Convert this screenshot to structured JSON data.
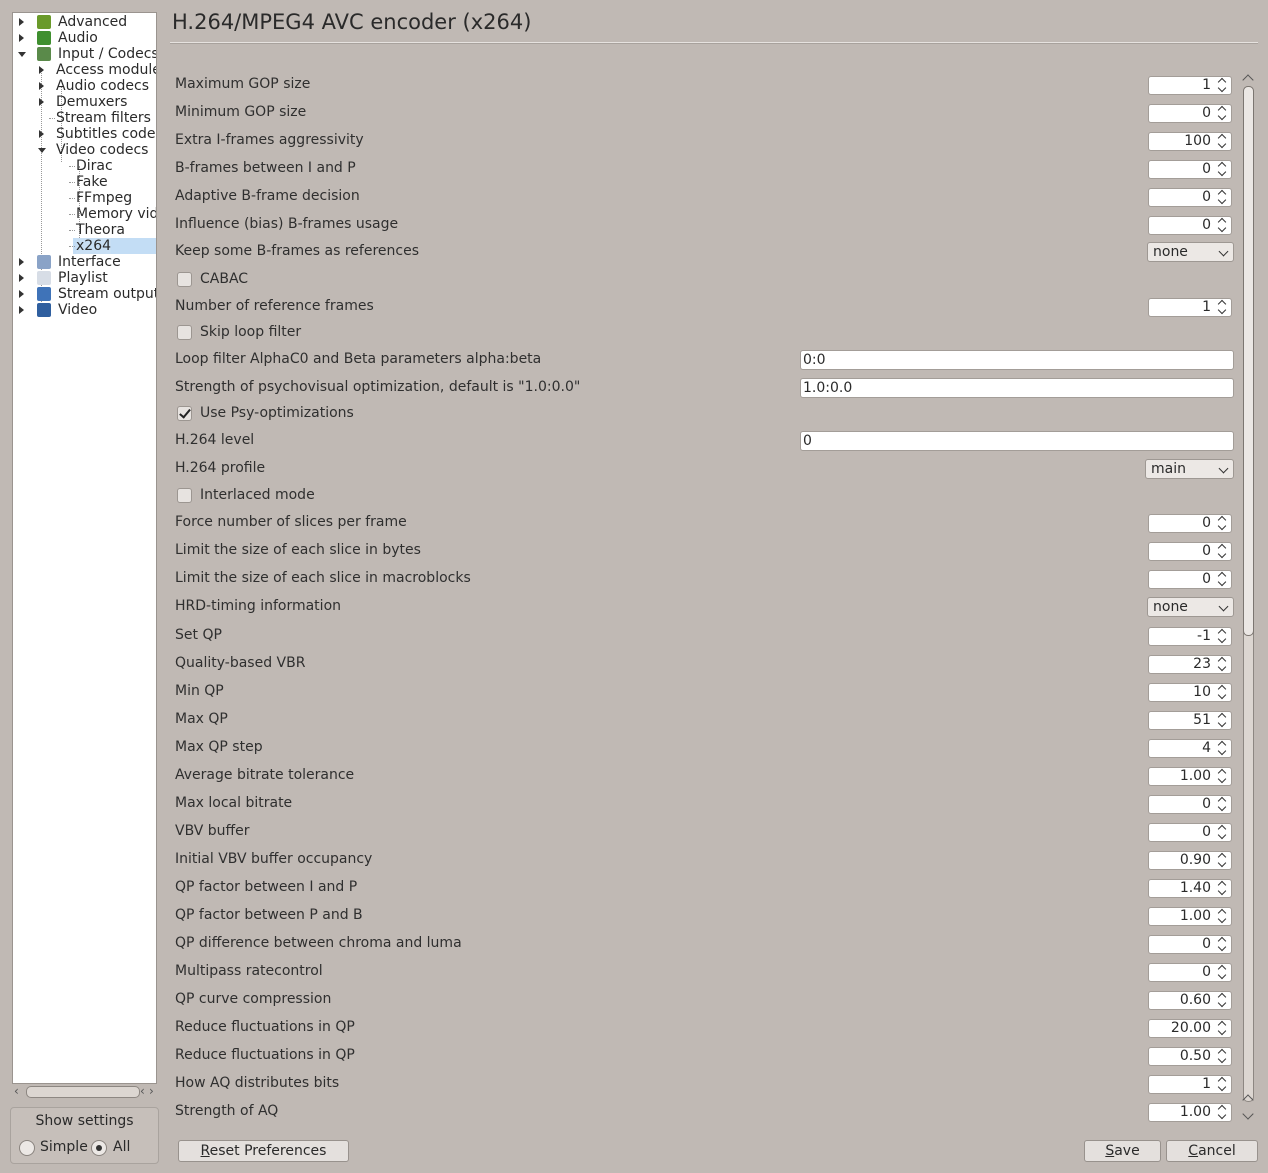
{
  "tree": {
    "items": [
      {
        "label": "Advanced",
        "icon": "chip-icon",
        "expander": "closed"
      },
      {
        "label": "Audio",
        "icon": "music-note-icon",
        "expander": "closed"
      },
      {
        "label": "Input / Codecs",
        "icon": "codecs-icon",
        "expander": "open"
      },
      {
        "label": "Access modules",
        "expander": "closed"
      },
      {
        "label": "Audio codecs",
        "expander": "closed"
      },
      {
        "label": "Demuxers",
        "expander": "closed"
      },
      {
        "label": "Stream filters"
      },
      {
        "label": "Subtitles codecs",
        "expander": "closed"
      },
      {
        "label": "Video codecs",
        "expander": "open"
      },
      {
        "label": "Dirac"
      },
      {
        "label": "Fake"
      },
      {
        "label": "FFmpeg"
      },
      {
        "label": "Memory video"
      },
      {
        "label": "Theora"
      },
      {
        "label": "x264",
        "selected": true
      },
      {
        "label": "Interface",
        "icon": "interface-icon",
        "expander": "closed"
      },
      {
        "label": "Playlist",
        "icon": "playlist-icon",
        "expander": "closed"
      },
      {
        "label": "Stream output",
        "icon": "stream-output-icon",
        "expander": "closed"
      },
      {
        "label": "Video",
        "icon": "film-icon",
        "expander": "closed"
      }
    ]
  },
  "show_settings": {
    "title": "Show settings",
    "simple": "Simple",
    "all": "All",
    "selected": "All"
  },
  "header": {
    "title": "H.264/MPEG4 AVC encoder (x264)"
  },
  "rows": [
    {
      "type": "spin",
      "label": "Maximum GOP size",
      "value": "1"
    },
    {
      "type": "spin",
      "label": "Minimum GOP size",
      "value": "0"
    },
    {
      "type": "spin",
      "label": "Extra I-frames aggressivity",
      "value": "100"
    },
    {
      "type": "spin",
      "label": "B-frames between I and P",
      "value": "0"
    },
    {
      "type": "spin",
      "label": "Adaptive B-frame decision",
      "value": "0"
    },
    {
      "type": "spin",
      "label": "Influence (bias) B-frames usage",
      "value": "0"
    },
    {
      "type": "combo",
      "label": "Keep some B-frames as references",
      "value": "none"
    },
    {
      "type": "check",
      "label": "CABAC",
      "checked": false
    },
    {
      "type": "spin",
      "label": "Number of reference frames",
      "value": "1"
    },
    {
      "type": "check",
      "label": "Skip loop filter",
      "checked": false
    },
    {
      "type": "text",
      "label": "Loop filter AlphaC0 and Beta parameters alpha:beta",
      "value": "0:0"
    },
    {
      "type": "text",
      "label": "Strength of psychovisual optimization, default is \"1.0:0.0\"",
      "value": "1.0:0.0"
    },
    {
      "type": "check",
      "label": "Use Psy-optimizations",
      "checked": true
    },
    {
      "type": "text",
      "label": "H.264 level",
      "value": "0"
    },
    {
      "type": "combo",
      "label": "H.264 profile",
      "value": "main"
    },
    {
      "type": "check",
      "label": "Interlaced mode",
      "checked": false
    },
    {
      "type": "spin",
      "label": "Force number of slices per frame",
      "value": "0"
    },
    {
      "type": "spin",
      "label": "Limit the size of each slice in bytes",
      "value": "0"
    },
    {
      "type": "spin",
      "label": "Limit the size of each slice in macroblocks",
      "value": "0"
    },
    {
      "type": "combo",
      "label": "HRD-timing information",
      "value": "none"
    },
    {
      "type": "spin",
      "label": "Set QP",
      "value": "-1"
    },
    {
      "type": "spin",
      "label": "Quality-based VBR",
      "value": "23"
    },
    {
      "type": "spin",
      "label": "Min QP",
      "value": "10"
    },
    {
      "type": "spin",
      "label": "Max QP",
      "value": "51"
    },
    {
      "type": "spin",
      "label": "Max QP step",
      "value": "4"
    },
    {
      "type": "spin",
      "label": "Average bitrate tolerance",
      "value": "1.00"
    },
    {
      "type": "spin",
      "label": "Max local bitrate",
      "value": "0"
    },
    {
      "type": "spin",
      "label": "VBV buffer",
      "value": "0"
    },
    {
      "type": "spin",
      "label": "Initial VBV buffer occupancy",
      "value": "0.90"
    },
    {
      "type": "spin",
      "label": "QP factor between I and P",
      "value": "1.40"
    },
    {
      "type": "spin",
      "label": "QP factor between P and B",
      "value": "1.00"
    },
    {
      "type": "spin",
      "label": "QP difference between chroma and luma",
      "value": "0"
    },
    {
      "type": "spin",
      "label": "Multipass ratecontrol",
      "value": "0"
    },
    {
      "type": "spin",
      "label": "QP curve compression",
      "value": "0.60"
    },
    {
      "type": "spin",
      "label": "Reduce fluctuations in QP",
      "value": "20.00"
    },
    {
      "type": "spin",
      "label": "Reduce fluctuations in QP",
      "value": "0.50"
    },
    {
      "type": "spin",
      "label": "How AQ distributes bits",
      "value": "1"
    },
    {
      "type": "spin",
      "label": "Strength of AQ",
      "value": "1.00"
    }
  ],
  "buttons": {
    "reset": "Reset Preferences",
    "save": "Save",
    "cancel": "Cancel"
  }
}
